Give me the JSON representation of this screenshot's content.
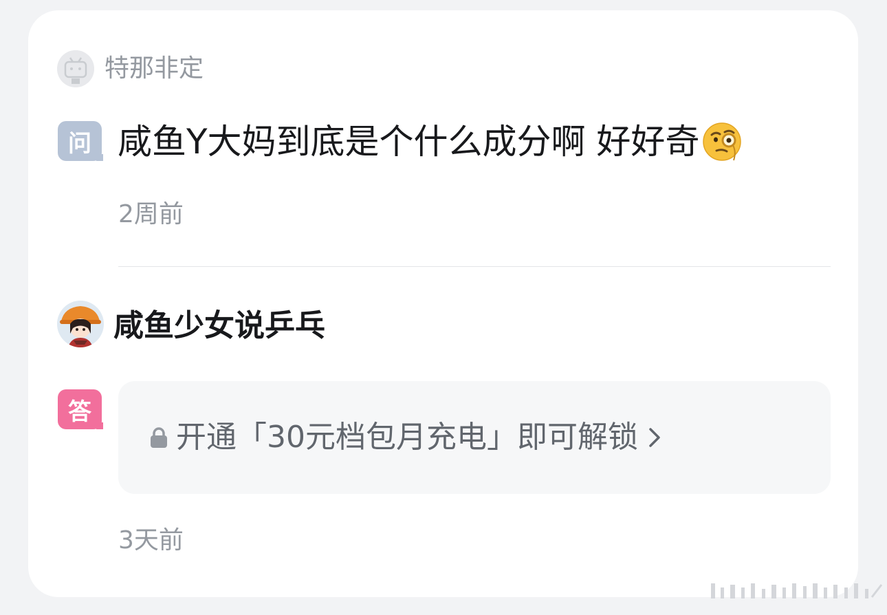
{
  "question": {
    "asker_name": "特那非定",
    "badge": "问",
    "text": "咸鱼Y大妈到底是个什么成分啊 好好奇",
    "emoji": "face-with-monocle-icon",
    "time": "2周前"
  },
  "answer": {
    "answerer_name": "咸鱼少女说乒乓",
    "badge": "答",
    "locked_text": "开通「30元档包月充电」即可解锁",
    "time": "3天前"
  },
  "colors": {
    "question_badge": "#b6c3d6",
    "answer_badge": "#f26f9c",
    "muted_text": "#9499a0",
    "primary_text": "#18191c"
  }
}
